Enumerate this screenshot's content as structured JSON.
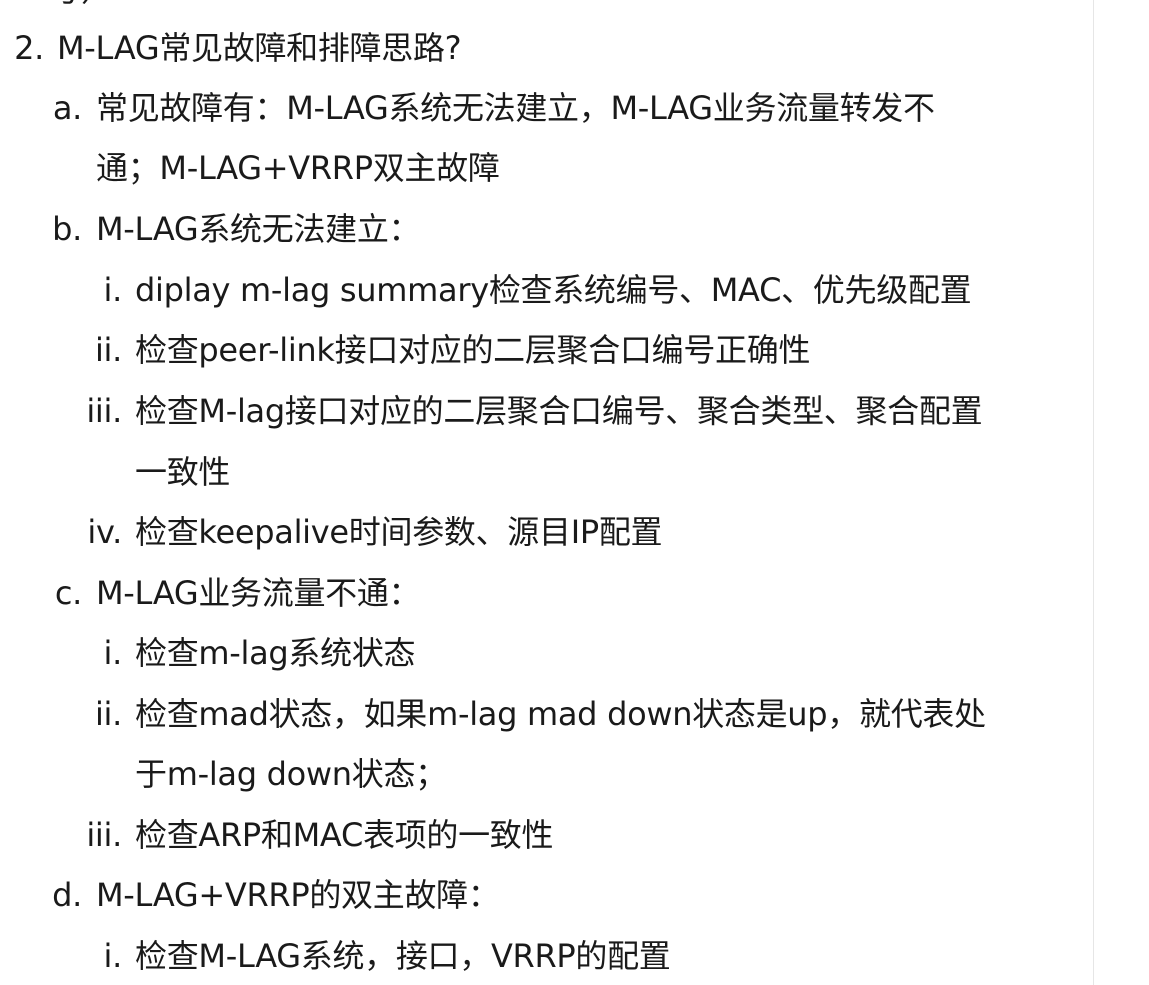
{
  "partial_top_line": "号）",
  "item": {
    "number": "2.",
    "title": "M-LAG常见故障和排障思路?",
    "sections": [
      {
        "marker": "a.",
        "lines": [
          "常见故障有：M-LAG系统无法建立，M-LAG业务流量转发不",
          "通；M-LAG+VRRP双主故障"
        ]
      },
      {
        "marker": "b.",
        "lines": [
          "M-LAG系统无法建立："
        ],
        "subitems": [
          {
            "marker": "i.",
            "lines": [
              "diplay m-lag summary检查系统编号、MAC、优先级配置"
            ]
          },
          {
            "marker": "ii.",
            "lines": [
              "检查peer-link接口对应的二层聚合口编号正确性"
            ]
          },
          {
            "marker": "iii.",
            "lines": [
              "检查M-lag接口对应的二层聚合口编号、聚合类型、聚合配置",
              "一致性"
            ]
          },
          {
            "marker": "iv.",
            "lines": [
              "检查keepalive时间参数、源目IP配置"
            ]
          }
        ]
      },
      {
        "marker": "c.",
        "lines": [
          "M-LAG业务流量不通："
        ],
        "subitems": [
          {
            "marker": "i.",
            "lines": [
              "检查m-lag系统状态"
            ]
          },
          {
            "marker": "ii.",
            "lines": [
              "检查mad状态，如果m-lag mad down状态是up，就代表处",
              "于m-lag down状态；"
            ]
          },
          {
            "marker": "iii.",
            "lines": [
              "检查ARP和MAC表项的一致性"
            ]
          }
        ]
      },
      {
        "marker": "d.",
        "lines": [
          "M-LAG+VRRP的双主故障："
        ],
        "subitems": [
          {
            "marker": "i.",
            "lines": [
              "检查M-LAG系统，接口，VRRP的配置"
            ]
          }
        ]
      }
    ]
  }
}
